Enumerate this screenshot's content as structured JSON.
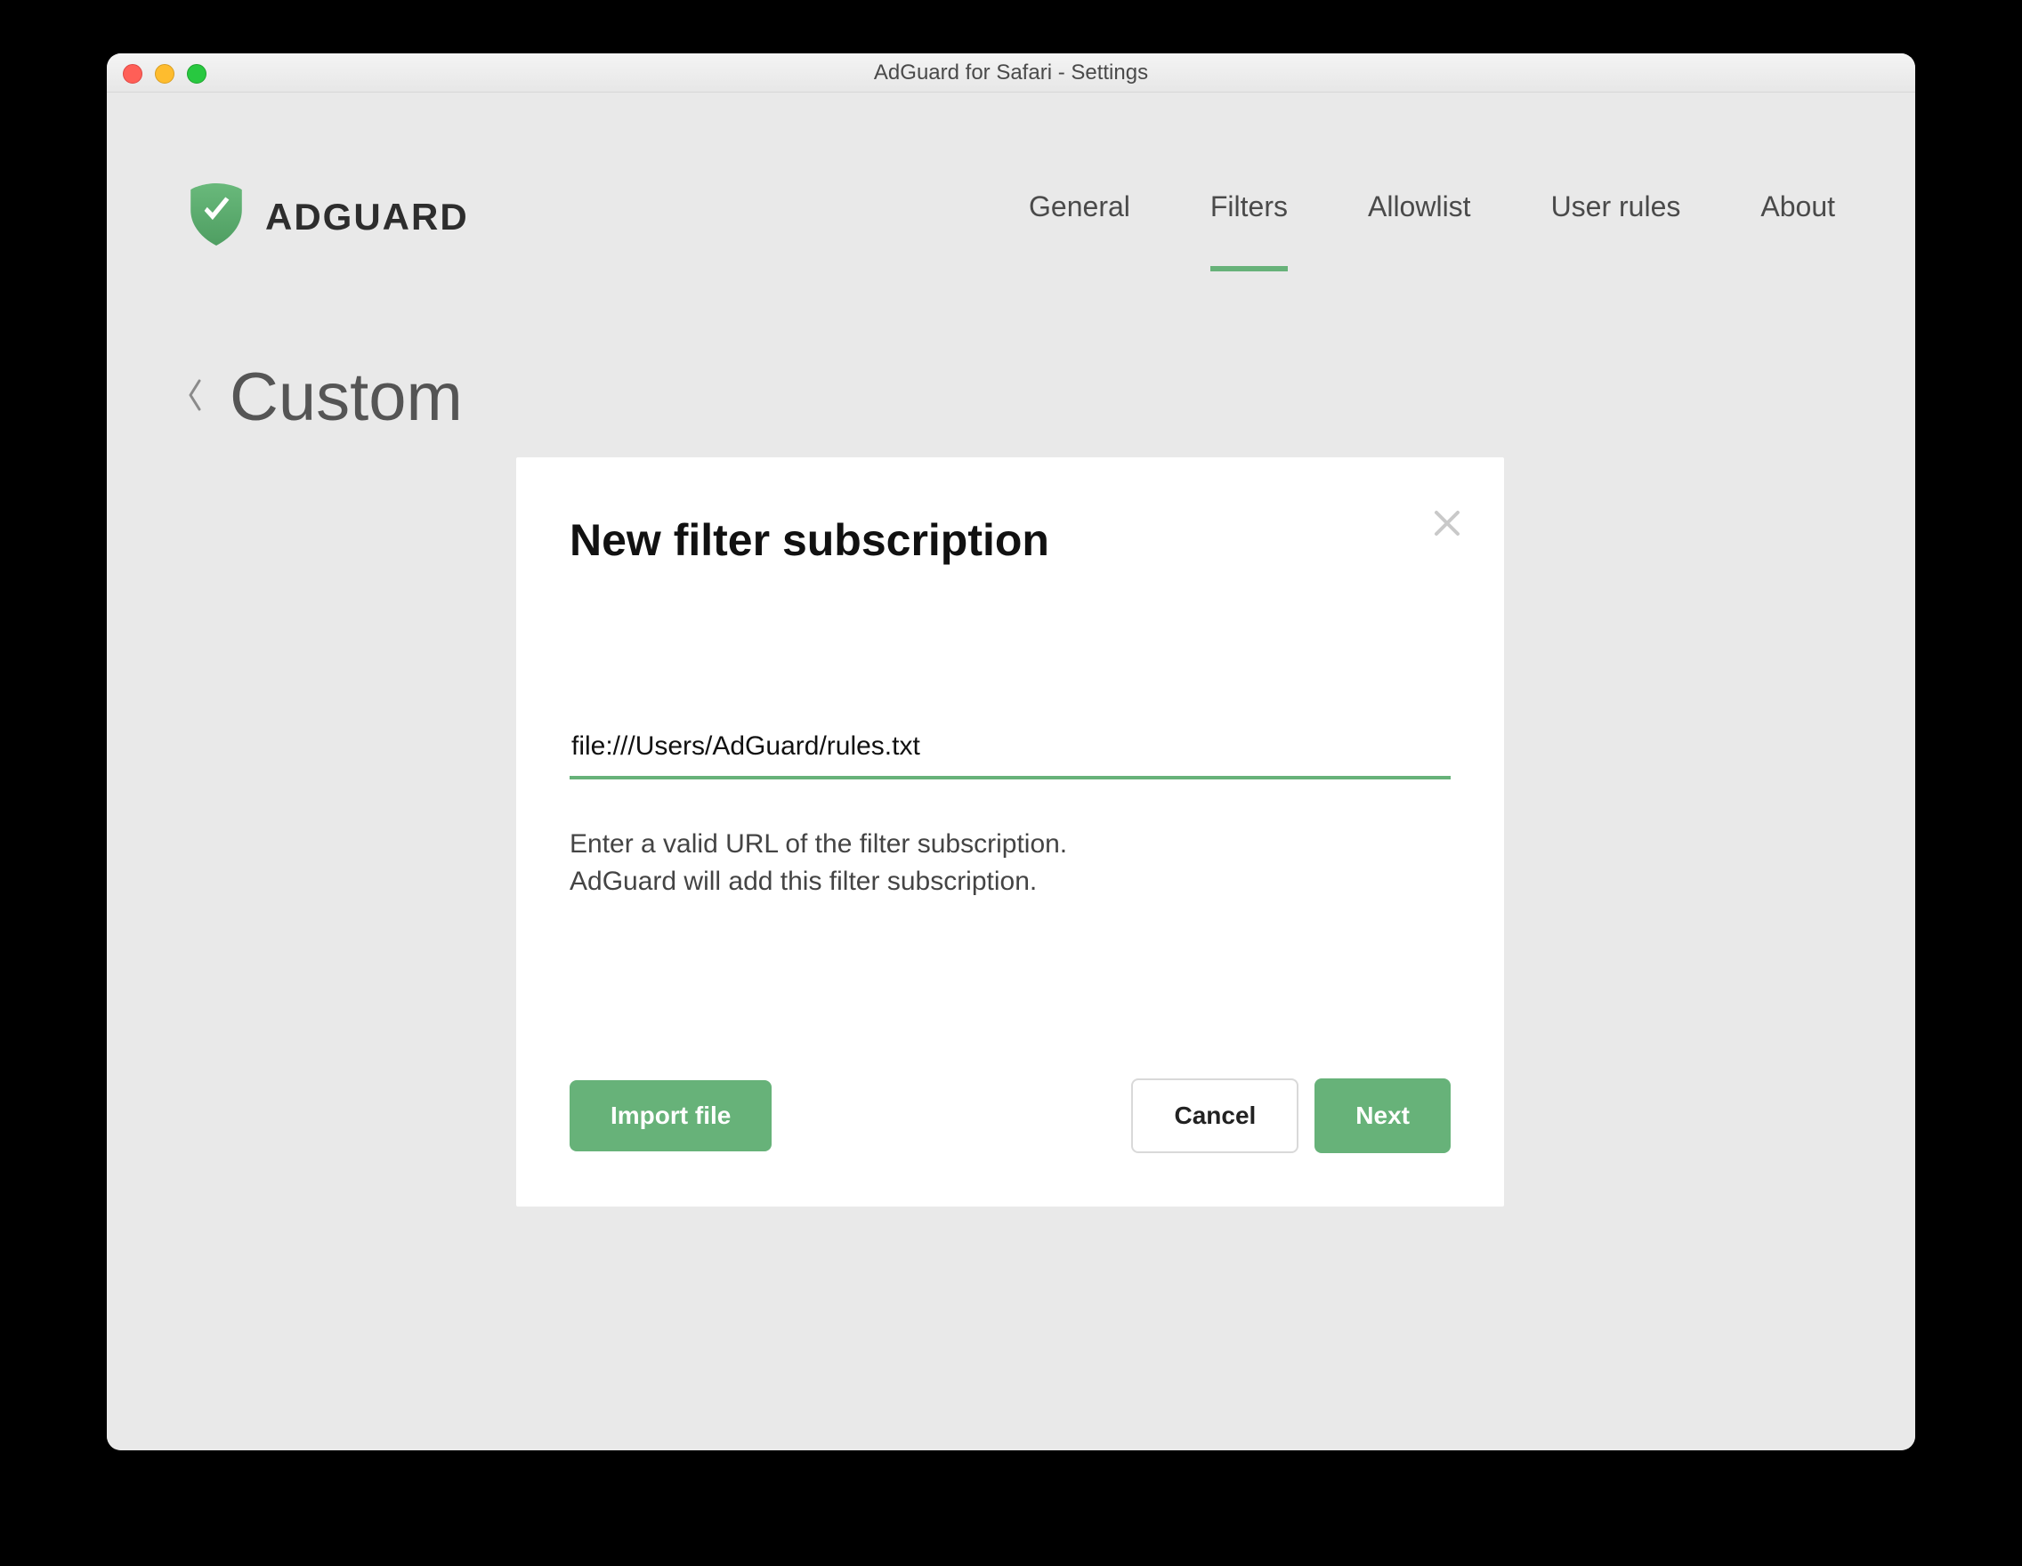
{
  "window": {
    "title": "AdGuard for Safari - Settings"
  },
  "brand": {
    "name": "ADGUARD"
  },
  "nav": {
    "items": [
      {
        "id": "general",
        "label": "General",
        "active": false
      },
      {
        "id": "filters",
        "label": "Filters",
        "active": true
      },
      {
        "id": "allowlist",
        "label": "Allowlist",
        "active": false
      },
      {
        "id": "userrules",
        "label": "User rules",
        "active": false
      },
      {
        "id": "about",
        "label": "About",
        "active": false
      }
    ]
  },
  "page": {
    "title": "Custom"
  },
  "modal": {
    "title": "New filter subscription",
    "url_value": "file:///Users/AdGuard/rules.txt",
    "help_line1": "Enter a valid URL of the filter subscription.",
    "help_line2": "AdGuard will add this filter subscription.",
    "buttons": {
      "import": "Import file",
      "cancel": "Cancel",
      "next": "Next"
    }
  },
  "colors": {
    "accent": "#67b279"
  }
}
